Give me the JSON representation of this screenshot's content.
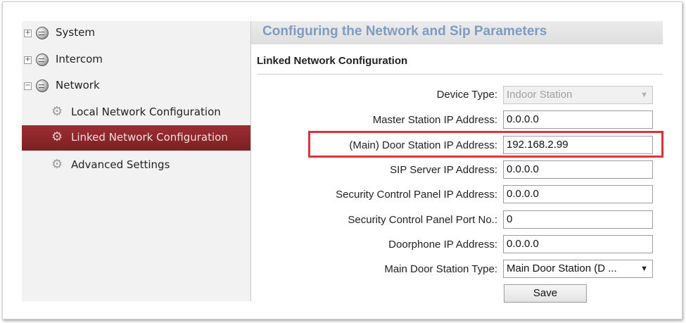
{
  "sidebar": {
    "items": [
      {
        "label": "System",
        "expander": "+",
        "icon": "globe-icon"
      },
      {
        "label": "Intercom",
        "expander": "+",
        "icon": "globe-icon"
      },
      {
        "label": "Network",
        "expander": "−",
        "icon": "globe-icon"
      },
      {
        "label": "Local Network Configuration",
        "icon": "gear-icon"
      },
      {
        "label": "Linked Network Configuration",
        "icon": "gear-icon",
        "selected": true
      },
      {
        "label": "Advanced Settings",
        "icon": "gear-icon"
      }
    ]
  },
  "main": {
    "title": "Configuring the Network and Sip Parameters",
    "section_title": "Linked Network Configuration",
    "form": {
      "device_type": {
        "label": "Device Type:",
        "value": "Indoor Station",
        "disabled": true
      },
      "master_station_ip": {
        "label": "Master Station IP Address:",
        "value": "0.0.0.0"
      },
      "main_door_station_ip": {
        "label": "(Main) Door Station IP Address:",
        "value": "192.168.2.99"
      },
      "sip_server_ip": {
        "label": "SIP Server IP Address:",
        "value": "0.0.0.0"
      },
      "security_panel_ip": {
        "label": "Security Control Panel IP Address:",
        "value": "0.0.0.0"
      },
      "security_panel_port": {
        "label": "Security Control Panel Port No.:",
        "value": "0"
      },
      "doorphone_ip": {
        "label": "Doorphone IP Address:",
        "value": "0.0.0.0"
      },
      "main_door_station_type": {
        "label": "Main Door Station Type:",
        "value": "Main Door Station (D ..."
      }
    },
    "save_label": "Save"
  },
  "colors": {
    "selected_bg": "#8b2528",
    "highlight_border": "#e0323a",
    "title_text": "#7e9bc4"
  }
}
